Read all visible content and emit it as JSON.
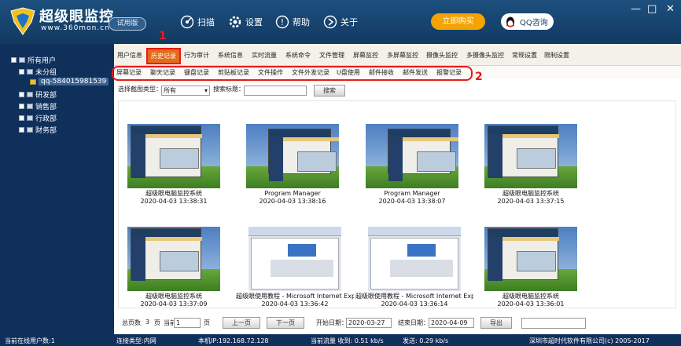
{
  "app": {
    "brand": "超级眼监控",
    "site": "www.360mon.cn",
    "trial": "试用版",
    "nav": [
      {
        "label": "扫描",
        "icon": "scan-icon"
      },
      {
        "label": "设置",
        "icon": "gear-icon"
      },
      {
        "label": "帮助",
        "icon": "help-icon"
      },
      {
        "label": "关于",
        "icon": "about-icon"
      }
    ],
    "buy": "立即购买",
    "qq": "QQ咨询",
    "window_controls": [
      "—",
      "□",
      "✕"
    ]
  },
  "tree": {
    "root": "所有用户",
    "group": "未分组",
    "user": "qq-584015981539",
    "depts": [
      "研发部",
      "销售部",
      "行政部",
      "财务部"
    ]
  },
  "tabs": [
    "用户信息",
    "历史记录",
    "行为审计",
    "系统信息",
    "实时流量",
    "系统命令",
    "文件管理",
    "屏幕监控",
    "多屏幕监控",
    "摄像头监控",
    "多摄像头监控",
    "常规设置",
    "限制设置"
  ],
  "active_tab": "历史记录",
  "subtabs": [
    "屏幕记录",
    "聊天记录",
    "键盘记录",
    "剪贴板记录",
    "文件操作",
    "文件外发记录",
    "U盘使用",
    "邮件接收",
    "邮件发送",
    "报警记录"
  ],
  "annotations": {
    "one": "1",
    "two": "2"
  },
  "filter": {
    "type_label": "选择截图类型：",
    "type_value": "所有",
    "title_label": "搜索标题：",
    "title_value": "",
    "search_button": "搜索"
  },
  "screenshots": [
    {
      "title": "超级眼电脑监控系统",
      "time": "2020-04-03 13:38:31",
      "kind": "app"
    },
    {
      "title": "Program Manager",
      "time": "2020-04-03 13:38:16",
      "kind": "app"
    },
    {
      "title": "Program Manager",
      "time": "2020-04-03 13:38:07",
      "kind": "app"
    },
    {
      "title": "超级眼电脑监控系统",
      "time": "2020-04-03 13:37:15",
      "kind": "app"
    },
    {
      "title": "超级眼电脑监控系统",
      "time": "2020-04-03 13:37:09",
      "kind": "app"
    },
    {
      "title": "超级眼使用教程 - Microsoft Internet Exp",
      "time": "2020-04-03 13:36:42",
      "kind": "doc"
    },
    {
      "title": "超级眼使用教程 - Microsoft Internet Exp",
      "time": "2020-04-03 13:36:14",
      "kind": "doc"
    },
    {
      "title": "超级眼电脑监控系统",
      "time": "2020-04-03 13:36:01",
      "kind": "app"
    }
  ],
  "pager": {
    "total_label": "总页数",
    "total": "3",
    "unit": "页",
    "current_label": "当前第",
    "current": "1",
    "prev": "上一页",
    "next": "下一页",
    "start_label": "开始日期：",
    "start_date": "2020-03-27",
    "end_label": "结束日期：",
    "end_date": "2020-04-09",
    "export": "导出"
  },
  "status": {
    "online": "当前在线用户数:1",
    "conn": "连接类型:内网",
    "ip": "本机IP:192.168.72.128",
    "traffic": "当前流量 收到: 0.51 kb/s",
    "sent": "发送: 0.29 kb/s",
    "copyright": "深圳市超时代软件有限公司(c) 2005-2017"
  },
  "colors": {
    "accent": "#e36b1a",
    "highlight": "#e81a1a",
    "titlebar": "#1d4f7e",
    "sidebar": "#10305c",
    "buy": "#f5a300"
  }
}
